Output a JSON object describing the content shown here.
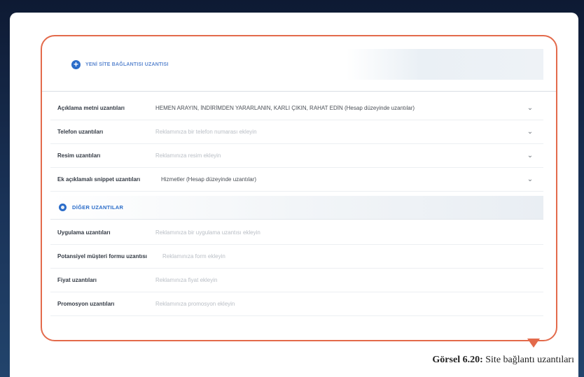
{
  "top_link": {
    "label": "YENİ SİTE BAĞLANTISI UZANTISI",
    "icon": "plus-circle-icon"
  },
  "extension_rows": [
    {
      "label": "Açıklama metni uzantıları",
      "value": "HEMEN ARAYIN, İNDİRİMDEN YARARLANIN, KARLI ÇIKIN, RAHAT EDİN (Hesap düzeyinde uzantılar)",
      "muted": false
    },
    {
      "label": "Telefon uzantıları",
      "value": "Reklamınıza bir telefon numarası ekleyin",
      "muted": true
    },
    {
      "label": "Resim uzantıları",
      "value": "Reklamınıza resim ekleyin",
      "muted": true
    },
    {
      "label": "Ek açıklamalı snippet uzantıları",
      "value": "Hizmetler (Hesap düzeyinde uzantılar)",
      "muted": false
    }
  ],
  "other_section": {
    "title": "DİĞER UZANTILAR",
    "icon": "gear-icon",
    "rows": [
      {
        "label": "Uygulama uzantıları",
        "value": "Reklamınıza bir uygulama uzantısı ekleyin"
      },
      {
        "label": "Potansiyel müşteri formu uzantısı",
        "value": "Reklamınıza form ekleyin"
      },
      {
        "label": "Fiyat uzantıları",
        "value": "Reklamınıza fiyat ekleyin"
      },
      {
        "label": "Promosyon uzantıları",
        "value": "Reklamınıza promosyon ekleyin"
      }
    ]
  },
  "caption": {
    "prefix": "Görsel 6.20:",
    "text": " Site bağlantı uzantıları"
  },
  "colors": {
    "accent": "#2a6cc9",
    "frame": "#e36a4b"
  }
}
